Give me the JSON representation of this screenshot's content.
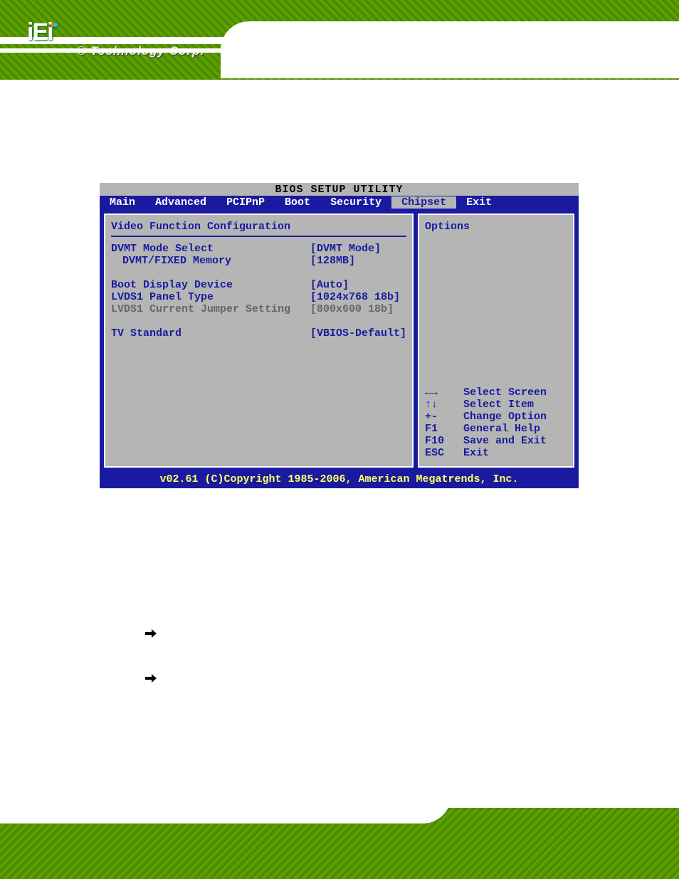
{
  "bios": {
    "title": "BIOS SETUP UTILITY",
    "tabs": [
      "Main",
      "Advanced",
      "PCIPnP",
      "Boot",
      "Security",
      "Chipset",
      "Exit"
    ],
    "active_tab": "Chipset",
    "section_title": "Video Function Configuration",
    "rows": [
      {
        "label": "DVMT Mode Select",
        "value": "[DVMT Mode]",
        "indent": false,
        "gray": false
      },
      {
        "label": "DVMT/FIXED Memory",
        "value": "[128MB]",
        "indent": true,
        "gray": false
      },
      {
        "label": "",
        "value": "",
        "indent": false,
        "gray": false
      },
      {
        "label": "Boot Display Device",
        "value": "[Auto]",
        "indent": false,
        "gray": false
      },
      {
        "label": "LVDS1 Panel Type",
        "value": "[1024x768 18b]",
        "indent": false,
        "gray": false
      },
      {
        "label": "LVDS1 Current Jumper Setting",
        "value": "[800x600 18b]",
        "indent": false,
        "gray": true
      },
      {
        "label": "",
        "value": "",
        "indent": false,
        "gray": false
      },
      {
        "label": "TV Standard",
        "value": "[VBIOS-Default]",
        "indent": false,
        "gray": false
      }
    ],
    "options_title": "Options",
    "hints": [
      {
        "key": "←→",
        "text": "Select Screen"
      },
      {
        "key": "↑↓",
        "text": "Select Item"
      },
      {
        "key": "+-",
        "text": "Change Option"
      },
      {
        "key": "F1",
        "text": "General Help"
      },
      {
        "key": "F10",
        "text": "Save and Exit"
      },
      {
        "key": "ESC",
        "text": "Exit"
      }
    ],
    "footer": "v02.61 (C)Copyright 1985-2006, American Megatrends, Inc."
  },
  "logo": {
    "main": "iEi",
    "sub": "® Technology Corp."
  },
  "arrow_items": [
    "",
    ""
  ]
}
